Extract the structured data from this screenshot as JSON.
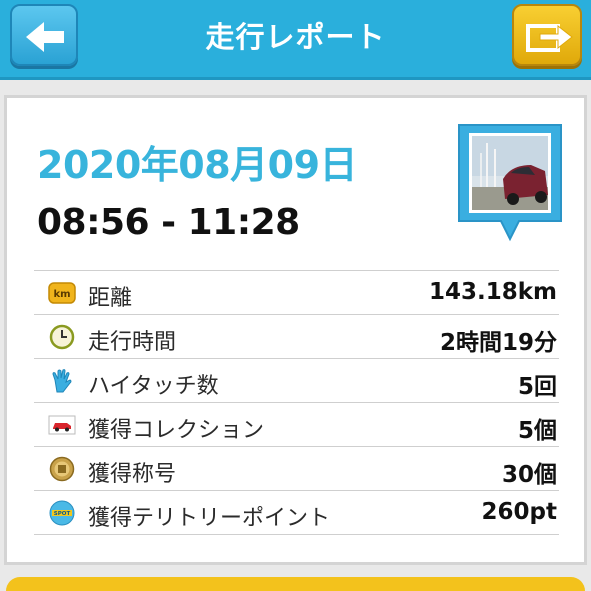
{
  "header": {
    "title": "走行レポート",
    "back_icon": "back-arrow-icon",
    "share_icon": "share-icon"
  },
  "report": {
    "date": "2020年08月09日",
    "time_range": "08:56 - 11:28",
    "photo": "car-photo-thumbnail"
  },
  "stats": [
    {
      "icon": "km-icon",
      "label": "距離",
      "value": "143.18km"
    },
    {
      "icon": "clock-icon",
      "label": "走行時間",
      "value": "2時間19分"
    },
    {
      "icon": "high-five-icon",
      "label": "ハイタッチ数",
      "value": "5回"
    },
    {
      "icon": "car-collection-icon",
      "label": "獲得コレクション",
      "value": "5個"
    },
    {
      "icon": "title-badge-icon",
      "label": "獲得称号",
      "value": "30個"
    },
    {
      "icon": "spot-icon",
      "label": "獲得テリトリーポイント",
      "value": "260pt"
    }
  ],
  "colors": {
    "header": "#2aafdc",
    "accent": "#38b4dc",
    "share_button": "#f3c21c"
  }
}
